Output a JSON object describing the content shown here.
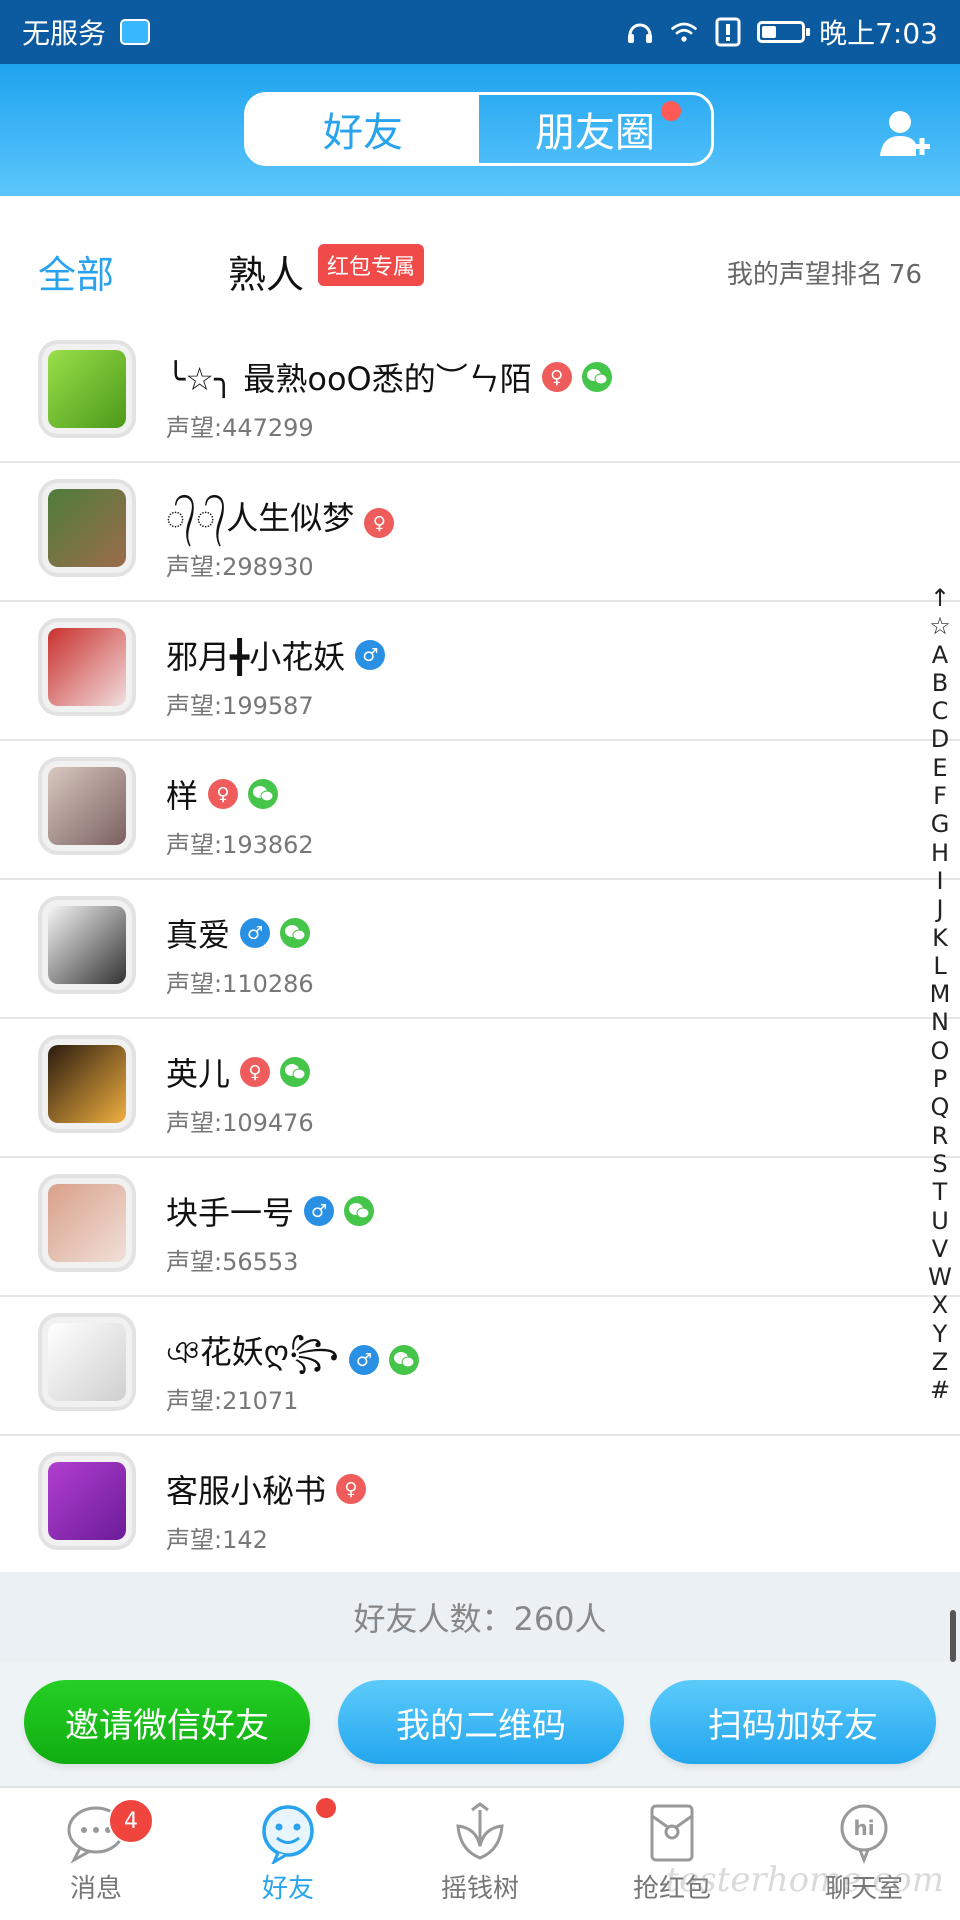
{
  "status_bar": {
    "carrier": "无服务",
    "time": "晚上7:03",
    "battery_level": 0.35,
    "icons": [
      "headset-icon",
      "wifi-icon",
      "alert-icon",
      "battery-icon"
    ]
  },
  "header": {
    "tabs": [
      {
        "label": "好友",
        "active": true
      },
      {
        "label": "朋友圈",
        "active": false,
        "has_dot": true
      }
    ],
    "add_friend_icon": "add-user-icon"
  },
  "filter": {
    "all_label": "全部",
    "acquaintance_label": "熟人",
    "red_packet_tag": "红包专属",
    "rank_label": "我的声望排名",
    "rank_value": "76"
  },
  "friends": [
    {
      "name": "╰☆╮ 最熟ooO悉的︶ㄣ陌",
      "reputation": "声望:447299",
      "gender": "female",
      "wechat": true
    },
    {
      "name": "᭄᭄人生似梦",
      "reputation": "声望:298930",
      "gender": "female",
      "wechat": false
    },
    {
      "name": "邪月╋小花妖",
      "reputation": "声望:199587",
      "gender": "male",
      "wechat": false
    },
    {
      "name": "样",
      "reputation": "声望:193862",
      "gender": "female",
      "wechat": true
    },
    {
      "name": "真爱",
      "reputation": "声望:110286",
      "gender": "male",
      "wechat": true
    },
    {
      "name": "英儿",
      "reputation": "声望:109476",
      "gender": "female",
      "wechat": true
    },
    {
      "name": "块手一号",
      "reputation": "声望:56553",
      "gender": "male",
      "wechat": true
    },
    {
      "name": "ঞ花妖ღ꧂",
      "reputation": "声望:21071",
      "gender": "male",
      "wechat": true
    },
    {
      "name": "客服小秘书",
      "reputation": "声望:142",
      "gender": "female",
      "wechat": false
    }
  ],
  "index_letters": [
    "↑",
    "☆",
    "A",
    "B",
    "C",
    "D",
    "E",
    "F",
    "G",
    "H",
    "I",
    "J",
    "K",
    "L",
    "M",
    "N",
    "O",
    "P",
    "Q",
    "R",
    "S",
    "T",
    "U",
    "V",
    "W",
    "X",
    "Y",
    "Z",
    "#"
  ],
  "footer": {
    "friend_count": "好友人数：260人"
  },
  "actions": {
    "invite_wechat": "邀请微信好友",
    "my_qrcode": "我的二维码",
    "scan_add": "扫码加好友"
  },
  "tab_bar": {
    "items": [
      {
        "label": "消息",
        "badge": "4"
      },
      {
        "label": "好友",
        "active": true
      },
      {
        "label": "摇钱树"
      },
      {
        "label": "抢红包"
      },
      {
        "label": "聊天室"
      }
    ]
  },
  "watermark": "testerhome.com",
  "colors": {
    "primary": "#2aa3ee",
    "status_bar": "#0c5aa0",
    "female": "#ee5d5b",
    "male": "#2a90e3",
    "wechat": "#45c54a",
    "invite_button": "#16b516",
    "badge": "#f0443f"
  }
}
